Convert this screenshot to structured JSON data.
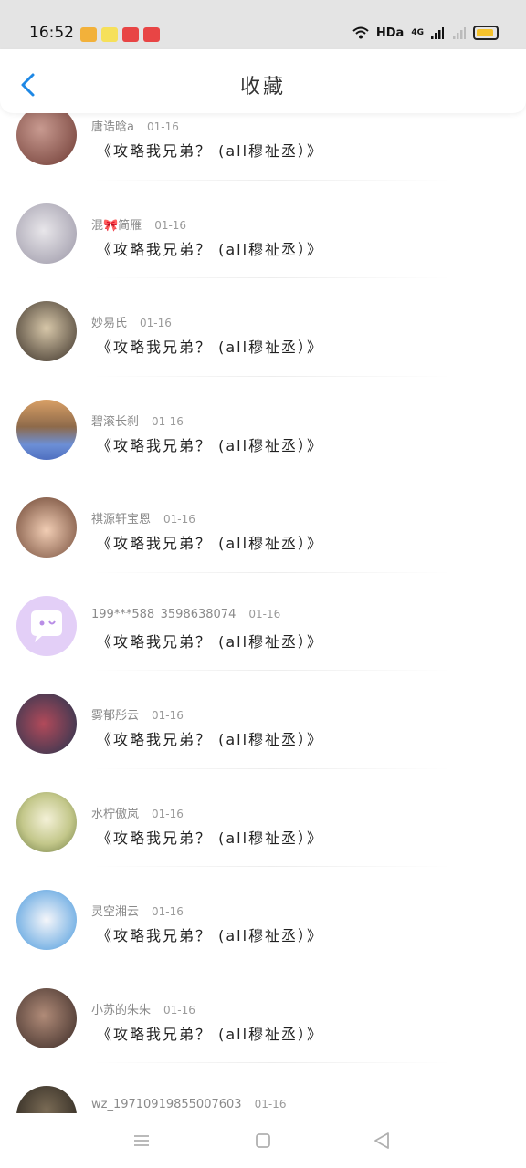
{
  "status_bar": {
    "time": "16:52",
    "network_label": "HDa",
    "cell_label": "4G",
    "battery_color": "#f5c22b"
  },
  "header": {
    "title": "收藏",
    "back_icon": "chevron-left-icon",
    "accent_color": "#1e88e5"
  },
  "items": [
    {
      "author": "唐诰晗a",
      "date": "01-16",
      "title": "《攻略我兄弟？ (all穆祉丞）》"
    },
    {
      "author": "混🎀简雁",
      "date": "01-16",
      "title": "《攻略我兄弟？ (all穆祉丞）》"
    },
    {
      "author": "妙易氏",
      "date": "01-16",
      "title": "《攻略我兄弟？ (all穆祉丞）》"
    },
    {
      "author": "碧滚长刹",
      "date": "01-16",
      "title": "《攻略我兄弟？ (all穆祉丞）》"
    },
    {
      "author": "祺源轩宝恩",
      "date": "01-16",
      "title": "《攻略我兄弟？ (all穆祉丞）》"
    },
    {
      "author": "199***588_3598638074",
      "date": "01-16",
      "title": "《攻略我兄弟？ (all穆祉丞）》"
    },
    {
      "author": "雾郁彤云",
      "date": "01-16",
      "title": "《攻略我兄弟？ (all穆祉丞）》"
    },
    {
      "author": "水柠傲岚",
      "date": "01-16",
      "title": "《攻略我兄弟？ (all穆祉丞）》"
    },
    {
      "author": "灵空湘云",
      "date": "01-16",
      "title": "《攻略我兄弟？ (all穆祉丞）》"
    },
    {
      "author": "小苏的朱朱",
      "date": "01-16",
      "title": "《攻略我兄弟？ (all穆祉丞）》"
    },
    {
      "author": "wz_19710919855007603",
      "date": "01-16",
      "title": ""
    }
  ],
  "nav": {
    "menu_icon": "menu-icon",
    "home_icon": "home-square-icon",
    "back_icon": "back-triangle-icon"
  }
}
